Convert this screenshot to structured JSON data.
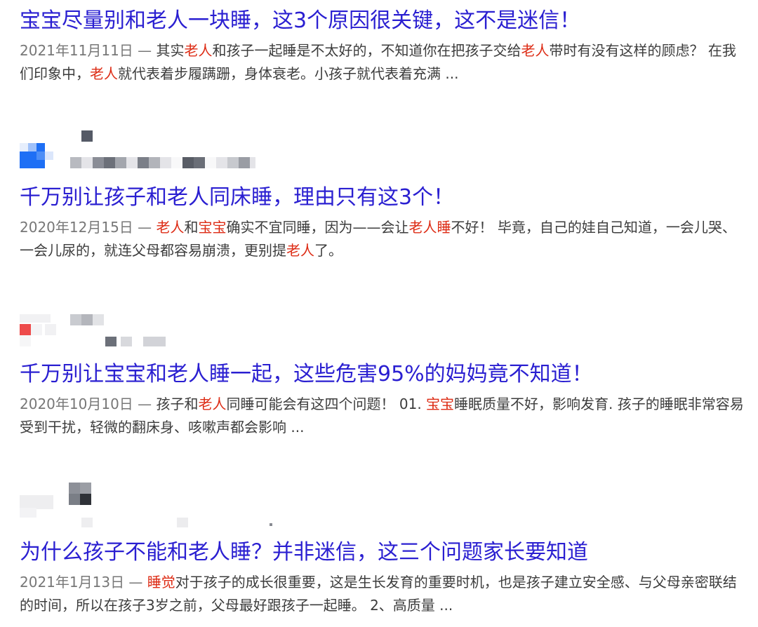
{
  "results": [
    {
      "title": "宝宝尽量别和老人一块睡，这3个原因很关键，这不是迷信！",
      "date": "2021年11月11日",
      "dash": " — ",
      "snippet": [
        {
          "text": "其实",
          "hl": false
        },
        {
          "text": "老人",
          "hl": true
        },
        {
          "text": "和孩子一起睡是不太好的，不知道你在把孩子交给",
          "hl": false
        },
        {
          "text": "老人",
          "hl": true
        },
        {
          "text": "带时有没有这样的顾虑？ 在我们印象中，",
          "hl": false
        },
        {
          "text": "老人",
          "hl": true
        },
        {
          "text": "就代表着步履蹒跚，身体衰老。小孩子就代表着充满 ...",
          "hl": false
        }
      ]
    },
    {
      "title": "千万别让孩子和老人同床睡，理由只有这3个！",
      "date": "2020年12月15日",
      "dash": " — ",
      "snippet": [
        {
          "text": "老人",
          "hl": true
        },
        {
          "text": "和",
          "hl": false
        },
        {
          "text": "宝宝",
          "hl": true
        },
        {
          "text": "确实不宜同睡，因为——会让",
          "hl": false
        },
        {
          "text": "老人睡",
          "hl": true
        },
        {
          "text": "不好！ 毕竟，自己的娃自己知道，一会儿哭、一会儿尿的，就连父母都容易崩溃，更别提",
          "hl": false
        },
        {
          "text": "老人",
          "hl": true
        },
        {
          "text": "了。",
          "hl": false
        }
      ]
    },
    {
      "title": "千万别让宝宝和老人睡一起，这些危害95%的妈妈竟不知道！",
      "date": "2020年10月10日",
      "dash": " — ",
      "snippet": [
        {
          "text": "孩子和",
          "hl": false
        },
        {
          "text": "老人",
          "hl": true
        },
        {
          "text": "同睡可能会有这四个问题！ 01. ",
          "hl": false
        },
        {
          "text": "宝宝",
          "hl": true
        },
        {
          "text": "睡眠质量不好，影响发育. 孩子的睡眠非常容易受到干扰，轻微的翻床身、咳嗽声都会影响 ...",
          "hl": false
        }
      ]
    },
    {
      "title": "为什么孩子不能和老人睡？并非迷信，这三个问题家长要知道",
      "date": "2021年1月13日",
      "dash": " — ",
      "snippet": [
        {
          "text": "睡觉",
          "hl": true
        },
        {
          "text": "对于孩子的成长很重要，这是生长发育的重要时机，也是孩子建立安全感、与父母亲密联结的时间，所以在孩子3岁之前，父母最好跟孩子一起睡。 2、高质量 ...",
          "hl": false
        }
      ]
    }
  ],
  "colors": {
    "title": "#2a1fd1",
    "snippet": "#3c3c3c",
    "date": "#777777",
    "highlight": "#dd2b14"
  }
}
